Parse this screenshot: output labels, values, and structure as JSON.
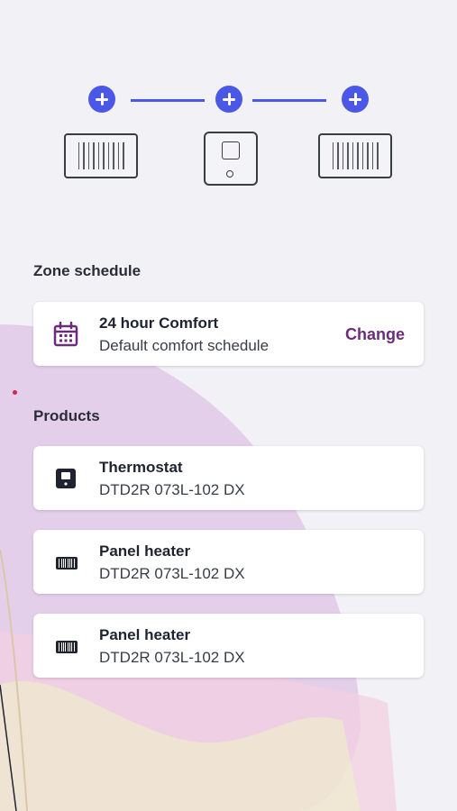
{
  "zone_diagram": {
    "items": [
      "radiator-icon",
      "thermostat-icon",
      "radiator-icon"
    ],
    "add_icon": "plus-icon",
    "accent_color": "#4b57e6"
  },
  "zone_schedule": {
    "heading": "Zone schedule",
    "card": {
      "icon": "calendar-icon",
      "title": "24 hour Comfort",
      "subtitle": "Default comfort schedule",
      "action_label": "Change"
    }
  },
  "products": {
    "heading": "Products",
    "items": [
      {
        "icon": "thermostat-icon",
        "title": "Thermostat",
        "model": "DTD2R 073L-102 DX"
      },
      {
        "icon": "radiator-icon",
        "title": "Panel heater",
        "model": "DTD2R 073L-102 DX"
      },
      {
        "icon": "radiator-icon",
        "title": "Panel heater",
        "model": "DTD2R 073L-102 DX"
      }
    ]
  },
  "colors": {
    "background": "#f2f1f6",
    "primary": "#4b57e6",
    "action": "#6b2d7a"
  }
}
